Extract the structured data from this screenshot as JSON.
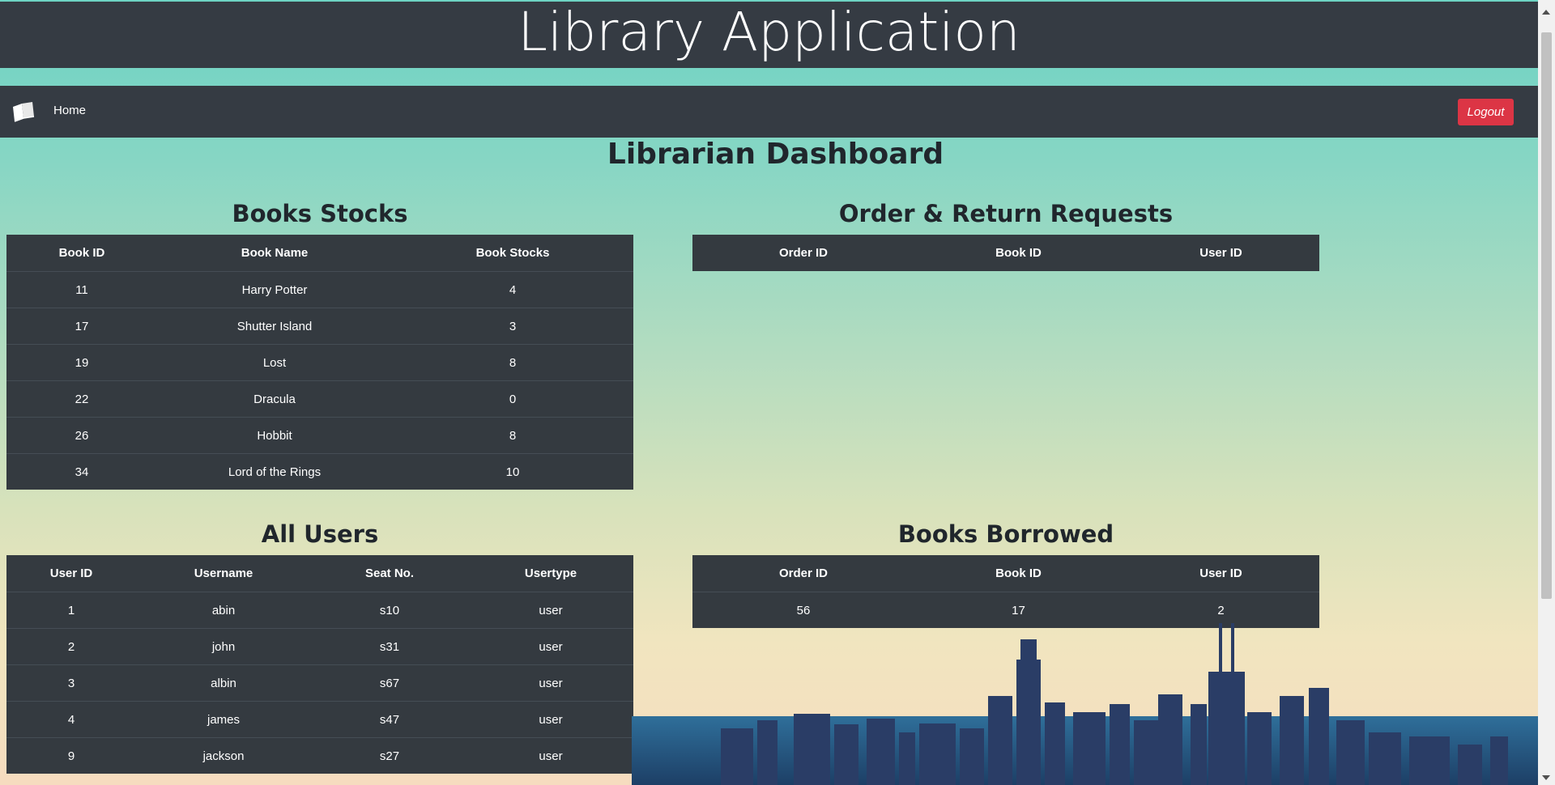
{
  "header": {
    "title": "Library Application"
  },
  "navbar": {
    "logo_icon": "open-book-icon",
    "home_label": "Home",
    "logout_label": "Logout"
  },
  "page": {
    "title": "Librarian Dashboard"
  },
  "books_stocks": {
    "title": "Books Stocks",
    "columns": [
      "Book ID",
      "Book Name",
      "Book Stocks"
    ],
    "rows": [
      [
        "11",
        "Harry Potter",
        "4"
      ],
      [
        "17",
        "Shutter Island",
        "3"
      ],
      [
        "19",
        "Lost",
        "8"
      ],
      [
        "22",
        "Dracula",
        "0"
      ],
      [
        "26",
        "Hobbit",
        "8"
      ],
      [
        "34",
        "Lord of the Rings",
        "10"
      ]
    ]
  },
  "order_requests": {
    "title": "Order & Return Requests",
    "columns": [
      "Order ID",
      "Book ID",
      "User ID"
    ],
    "rows": []
  },
  "all_users": {
    "title": "All Users",
    "columns": [
      "User ID",
      "Username",
      "Seat No.",
      "Usertype"
    ],
    "rows": [
      [
        "1",
        "abin",
        "s10",
        "user"
      ],
      [
        "2",
        "john",
        "s31",
        "user"
      ],
      [
        "3",
        "albin",
        "s67",
        "user"
      ],
      [
        "4",
        "james",
        "s47",
        "user"
      ],
      [
        "9",
        "jackson",
        "s27",
        "user"
      ]
    ]
  },
  "books_borrowed": {
    "title": "Books Borrowed",
    "columns": [
      "Order ID",
      "Book ID",
      "User ID"
    ],
    "rows": [
      [
        "56",
        "17",
        "2"
      ]
    ]
  }
}
